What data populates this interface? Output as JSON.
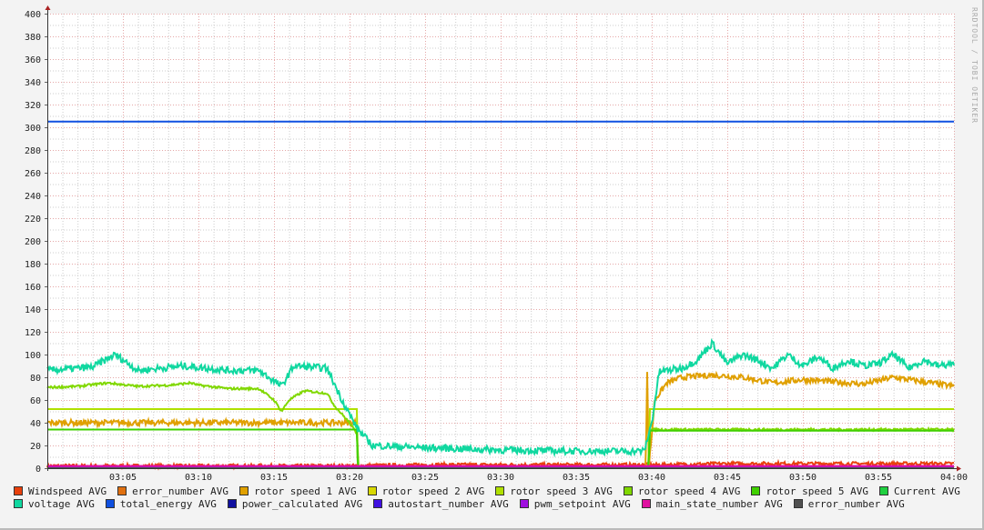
{
  "watermark": "RRDTOOL / TOBI OETIKER",
  "chart_data": {
    "type": "line",
    "title": "",
    "xlabel": "",
    "ylabel": "",
    "xlim_minutes_after_0300": [
      0,
      60
    ],
    "ylim": [
      0,
      400
    ],
    "y_ticks": [
      0,
      20,
      40,
      60,
      80,
      100,
      120,
      140,
      160,
      180,
      200,
      220,
      240,
      260,
      280,
      300,
      320,
      340,
      360,
      380,
      400
    ],
    "x_ticks": [
      {
        "m": 5,
        "label": "03:05"
      },
      {
        "m": 10,
        "label": "03:10"
      },
      {
        "m": 15,
        "label": "03:15"
      },
      {
        "m": 20,
        "label": "03:20"
      },
      {
        "m": 25,
        "label": "03:25"
      },
      {
        "m": 30,
        "label": "03:30"
      },
      {
        "m": 35,
        "label": "03:35"
      },
      {
        "m": 40,
        "label": "03:40"
      },
      {
        "m": 45,
        "label": "03:45"
      },
      {
        "m": 50,
        "label": "03:50"
      },
      {
        "m": 55,
        "label": "03:55"
      },
      {
        "m": 60,
        "label": "04:00"
      }
    ],
    "grid": true,
    "legend_position": "bottom",
    "series": [
      {
        "name": "Windspeed AVG",
        "color": "#e8400c",
        "noise": 1.5,
        "points": [
          [
            0,
            2
          ],
          [
            20,
            2
          ],
          [
            25,
            3
          ],
          [
            40,
            3
          ],
          [
            45,
            4
          ],
          [
            60,
            4
          ]
        ]
      },
      {
        "name": "error_number AVG",
        "color": "#e07010",
        "noise": 0,
        "points": [
          [
            0,
            0
          ],
          [
            60,
            0
          ]
        ]
      },
      {
        "name": "rotor speed 1 AVG",
        "color": "#e0a000",
        "noise": 2.5,
        "points": [
          [
            0,
            40
          ],
          [
            20.5,
            40
          ],
          [
            20.55,
            0
          ],
          [
            39.6,
            0
          ],
          [
            39.7,
            85
          ],
          [
            39.8,
            0
          ],
          [
            40.2,
            60
          ],
          [
            41,
            75
          ],
          [
            42,
            80
          ],
          [
            44,
            82
          ],
          [
            46,
            80
          ],
          [
            48,
            75
          ],
          [
            50,
            78
          ],
          [
            52,
            76
          ],
          [
            54,
            74
          ],
          [
            56,
            80
          ],
          [
            58,
            76
          ],
          [
            60,
            72
          ]
        ]
      },
      {
        "name": "rotor speed 2 AVG",
        "color": "#d8d800",
        "noise": 0,
        "points": [
          [
            0,
            0
          ],
          [
            60,
            0
          ]
        ]
      },
      {
        "name": "rotor speed 3 AVG",
        "color": "#b0e000",
        "noise": 0,
        "points": [
          [
            0,
            52
          ],
          [
            20.5,
            52
          ],
          [
            20.55,
            0
          ],
          [
            39.8,
            0
          ],
          [
            39.85,
            52
          ],
          [
            60,
            52
          ]
        ]
      },
      {
        "name": "rotor speed 4 AVG",
        "color": "#80d800",
        "noise": 1,
        "points": [
          [
            0,
            71
          ],
          [
            2,
            72
          ],
          [
            4,
            75
          ],
          [
            6,
            72
          ],
          [
            8,
            73
          ],
          [
            9.5,
            75
          ],
          [
            10,
            73
          ],
          [
            12,
            70
          ],
          [
            14,
            70
          ],
          [
            15,
            60
          ],
          [
            15.5,
            50
          ],
          [
            16,
            60
          ],
          [
            17,
            68
          ],
          [
            18.5,
            66
          ],
          [
            19,
            55
          ],
          [
            20,
            40
          ],
          [
            20.5,
            30
          ],
          [
            20.6,
            0
          ],
          [
            39.8,
            0
          ],
          [
            39.85,
            34
          ],
          [
            60,
            34
          ]
        ]
      },
      {
        "name": "rotor speed 5 AVG",
        "color": "#40d000",
        "noise": 0,
        "points": [
          [
            0,
            34
          ],
          [
            20.5,
            34
          ],
          [
            20.55,
            0
          ],
          [
            39.8,
            0
          ],
          [
            39.85,
            33
          ],
          [
            60,
            33
          ]
        ]
      },
      {
        "name": "Current AVG",
        "color": "#20d040",
        "noise": 0,
        "points": [
          [
            0,
            1
          ],
          [
            60,
            1
          ]
        ]
      },
      {
        "name": "voltage AVG",
        "color": "#10d8a0",
        "noise": 3,
        "points": [
          [
            0,
            86
          ],
          [
            3,
            89
          ],
          [
            4.5,
            100
          ],
          [
            6,
            86
          ],
          [
            9,
            90
          ],
          [
            12,
            86
          ],
          [
            14,
            86
          ],
          [
            15.5,
            72
          ],
          [
            16.3,
            90
          ],
          [
            18.5,
            88
          ],
          [
            19.5,
            60
          ],
          [
            20.5,
            35
          ],
          [
            21.5,
            20
          ],
          [
            25,
            18
          ],
          [
            30,
            16
          ],
          [
            35,
            15
          ],
          [
            39.5,
            15
          ],
          [
            40,
            40
          ],
          [
            40.5,
            85
          ],
          [
            42,
            88
          ],
          [
            43,
            95
          ],
          [
            44,
            110
          ],
          [
            45,
            92
          ],
          [
            46,
            100
          ],
          [
            47,
            95
          ],
          [
            48,
            88
          ],
          [
            49,
            100
          ],
          [
            50,
            90
          ],
          [
            51,
            98
          ],
          [
            52,
            88
          ],
          [
            53,
            95
          ],
          [
            54,
            90
          ],
          [
            55,
            92
          ],
          [
            56,
            100
          ],
          [
            57,
            88
          ],
          [
            58,
            95
          ],
          [
            59,
            90
          ],
          [
            60,
            92
          ]
        ]
      },
      {
        "name": "total_energy AVG",
        "color": "#1050e0",
        "noise": 0,
        "points": [
          [
            0,
            305
          ],
          [
            60,
            305
          ]
        ]
      },
      {
        "name": "power_calculated AVG",
        "color": "#1010a0",
        "noise": 0,
        "points": [
          [
            0,
            0
          ],
          [
            60,
            0
          ]
        ]
      },
      {
        "name": "autostart_number AVG",
        "color": "#4010e0",
        "noise": 0,
        "points": [
          [
            0,
            0
          ],
          [
            60,
            0
          ]
        ]
      },
      {
        "name": "pwm_setpoint AVG",
        "color": "#a010e0",
        "noise": 0,
        "points": [
          [
            0,
            1
          ],
          [
            60,
            1
          ]
        ]
      },
      {
        "name": "main_state_number AVG",
        "color": "#e010a0",
        "noise": 0,
        "points": [
          [
            0,
            2
          ],
          [
            60,
            2
          ]
        ]
      },
      {
        "name": "error_number AVG",
        "color": "#505050",
        "noise": 0,
        "points": [
          [
            0,
            0
          ],
          [
            60,
            0
          ]
        ]
      }
    ]
  }
}
